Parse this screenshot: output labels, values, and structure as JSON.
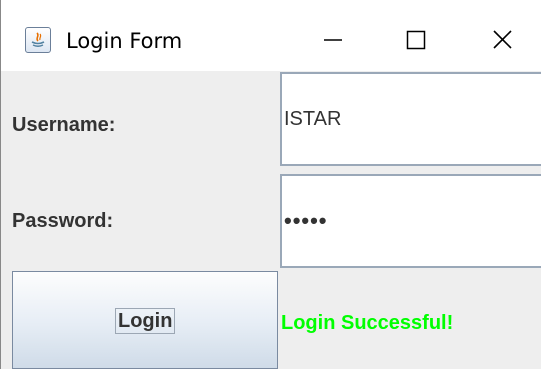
{
  "window": {
    "title": "Login Form",
    "icon": "java-icon",
    "controls": [
      "minimize-icon",
      "maximize-icon",
      "close-icon"
    ]
  },
  "form": {
    "username_label": "Username:",
    "username_value": "ISTAR",
    "password_label": "Password:",
    "password_masked": "•••••",
    "login_button_label": "Login",
    "status_message": "Login Successful!",
    "status_color": "#00ff00"
  },
  "colors": {
    "background": "#eeeeee",
    "field_background": "#ffffff",
    "label_text": "#333333"
  }
}
